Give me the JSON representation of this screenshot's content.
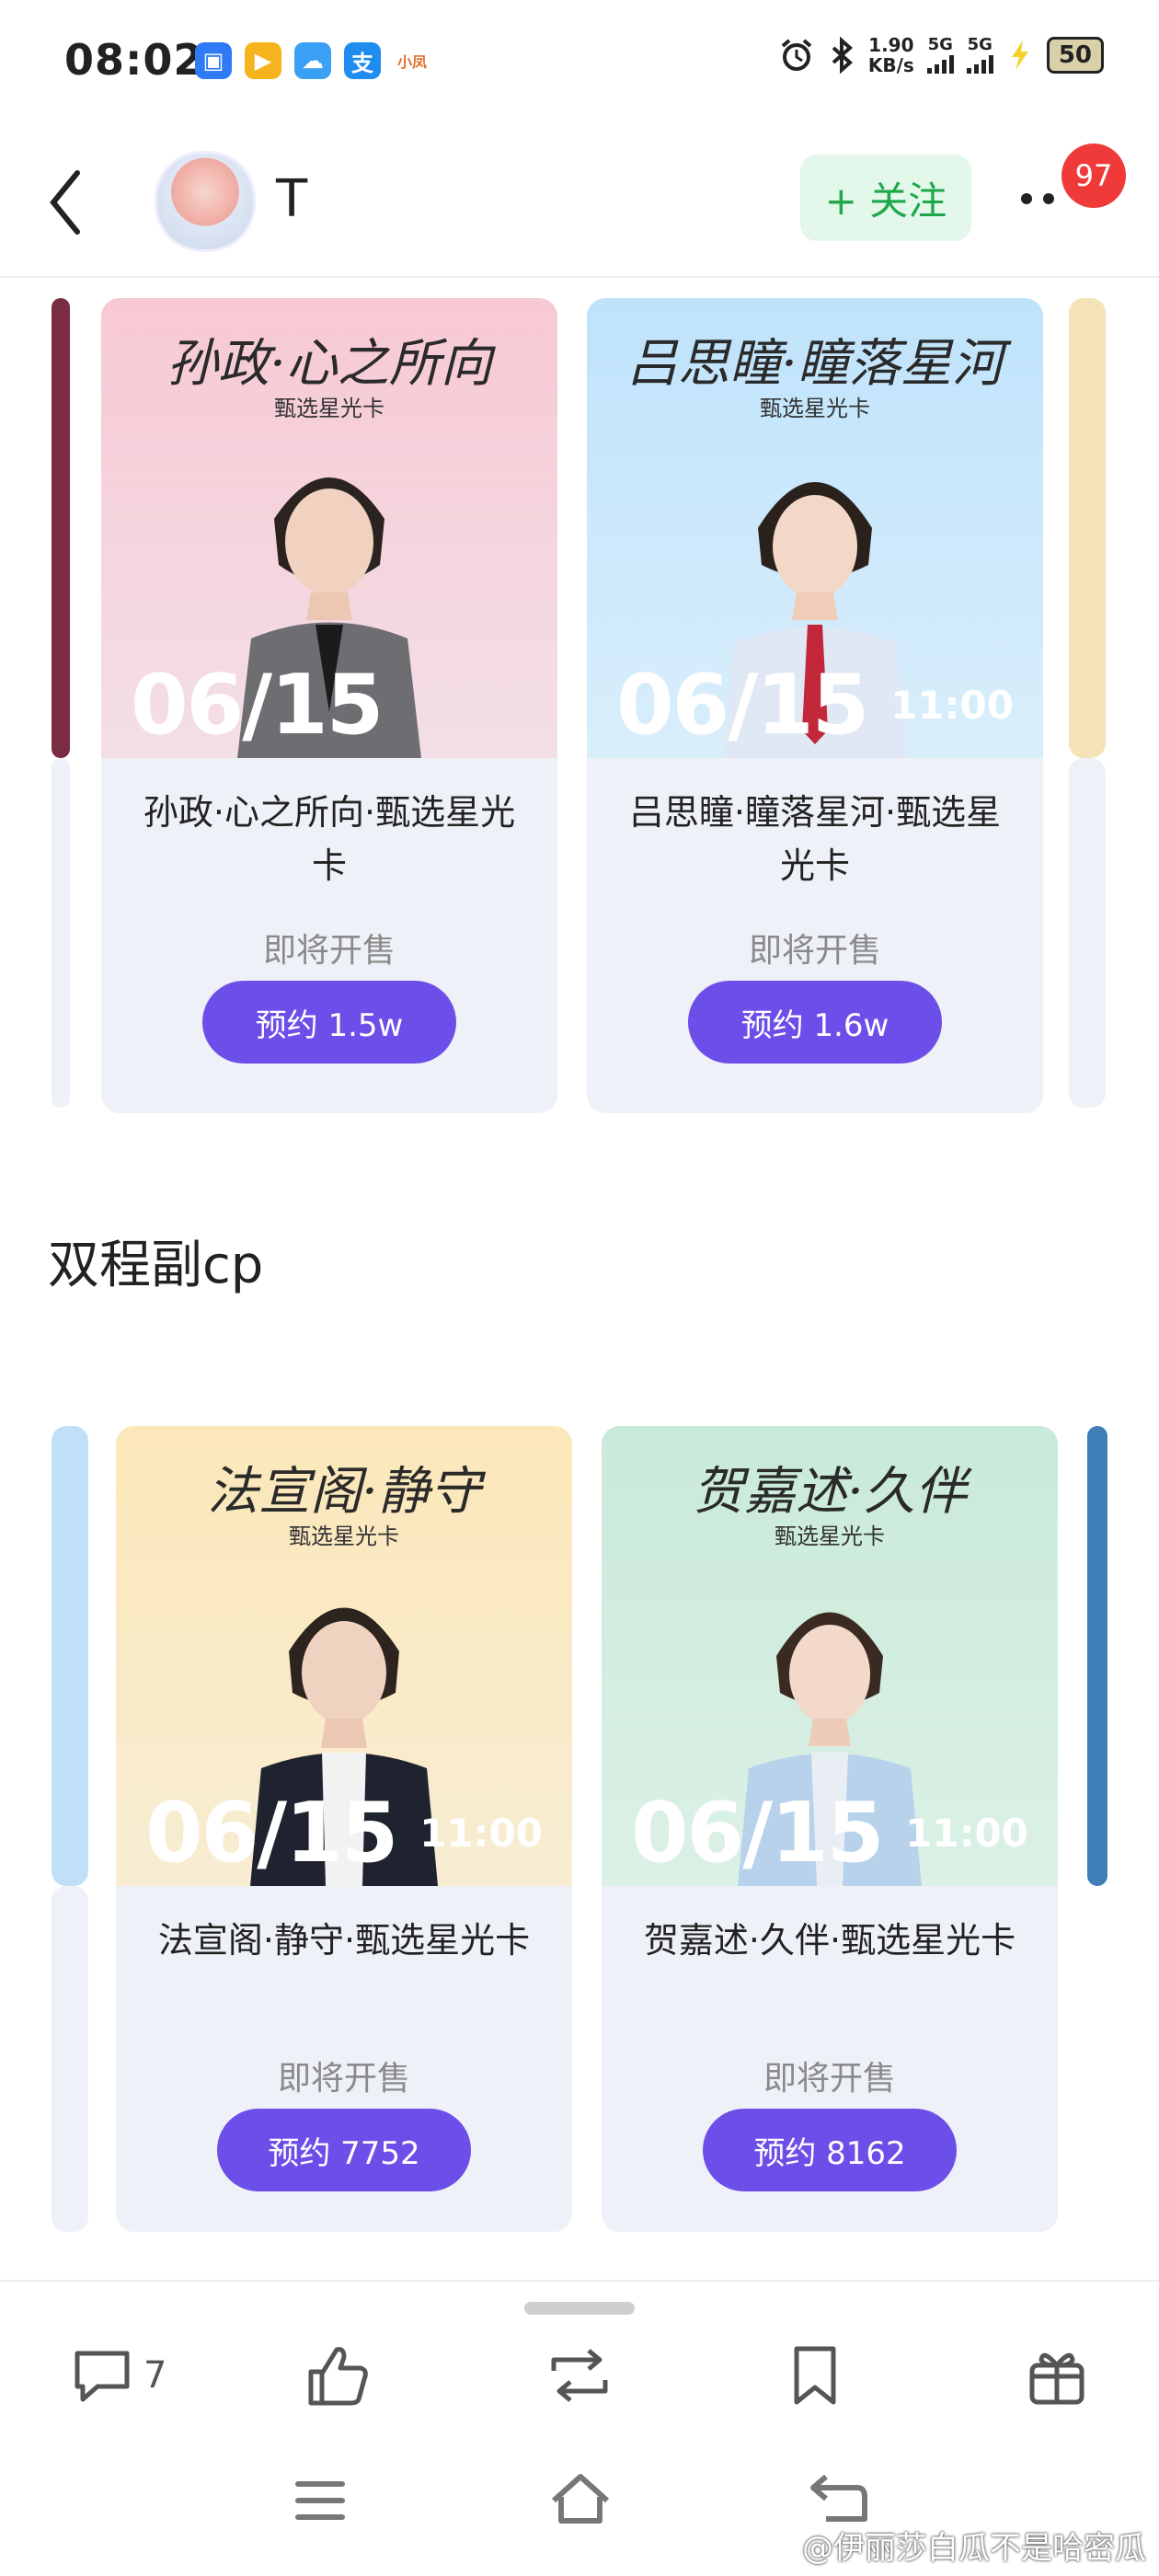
{
  "status_bar": {
    "time": "08:02",
    "app_icons": [
      {
        "icon": "store-icon",
        "color": "#2f7bf5",
        "glyph": "▣"
      },
      {
        "icon": "video-icon",
        "color": "#f5b31d",
        "glyph": "▶"
      },
      {
        "icon": "cloud-icon",
        "color": "#3aa0f5",
        "glyph": "☁"
      },
      {
        "icon": "alipay-icon",
        "color": "#1f8cf0",
        "glyph": "支"
      },
      {
        "icon": "xiaomi-icon",
        "color": "#ffffff",
        "glyph": "小凤"
      }
    ],
    "net_speed_value": "1.90",
    "net_speed_unit": "KB/s",
    "signal1": "5G",
    "signal2": "5G",
    "battery": "50"
  },
  "header": {
    "user_name": "T",
    "follow_label": "+ 关注",
    "badge_count": "97"
  },
  "row1": {
    "cards": [
      {
        "script_title": "孙政·心之所向",
        "sub_tag": "甄选星光卡",
        "date": "06/15",
        "time": "",
        "name": "孙政·心之所向·甄选星光卡",
        "status": "即将开售",
        "reserve": "预约 1.5w",
        "bg_top": "#f7c9d4",
        "bg_bottom": "#f3dfe6"
      },
      {
        "script_title": "吕思瞳·瞳落星河",
        "sub_tag": "甄选星光卡",
        "date": "06/15",
        "time": "11:00",
        "name": "吕思瞳·瞳落星河·甄选星光卡",
        "status": "即将开售",
        "reserve": "预约 1.6w",
        "bg_top": "#bfe3fb",
        "bg_bottom": "#d9eefb"
      }
    ]
  },
  "section": {
    "title": "双程副cp"
  },
  "row2": {
    "cards": [
      {
        "script_title": "法宣阁·静守",
        "sub_tag": "甄选星光卡",
        "date": "06/15",
        "time": "11:00",
        "name": "法宣阁·静守·甄选星光卡",
        "status": "即将开售",
        "reserve": "预约 7752",
        "bg_top": "#fbe7b9",
        "bg_bottom": "#f8edd3"
      },
      {
        "script_title": "贺嘉述·久伴",
        "sub_tag": "甄选星光卡",
        "date": "06/15",
        "time": "11:00",
        "name": "贺嘉述·久伴·甄选星光卡",
        "status": "即将开售",
        "reserve": "预约 8162",
        "bg_top": "#c9ead9",
        "bg_bottom": "#dcf1e6"
      }
    ]
  },
  "action_bar": {
    "comment_count": "7"
  },
  "watermark": "@伊丽莎白瓜不是哈密瓜",
  "colors": {
    "accent": "#6c4fe8",
    "follow_green": "#1ea84a",
    "badge_red": "#f03a3a"
  }
}
